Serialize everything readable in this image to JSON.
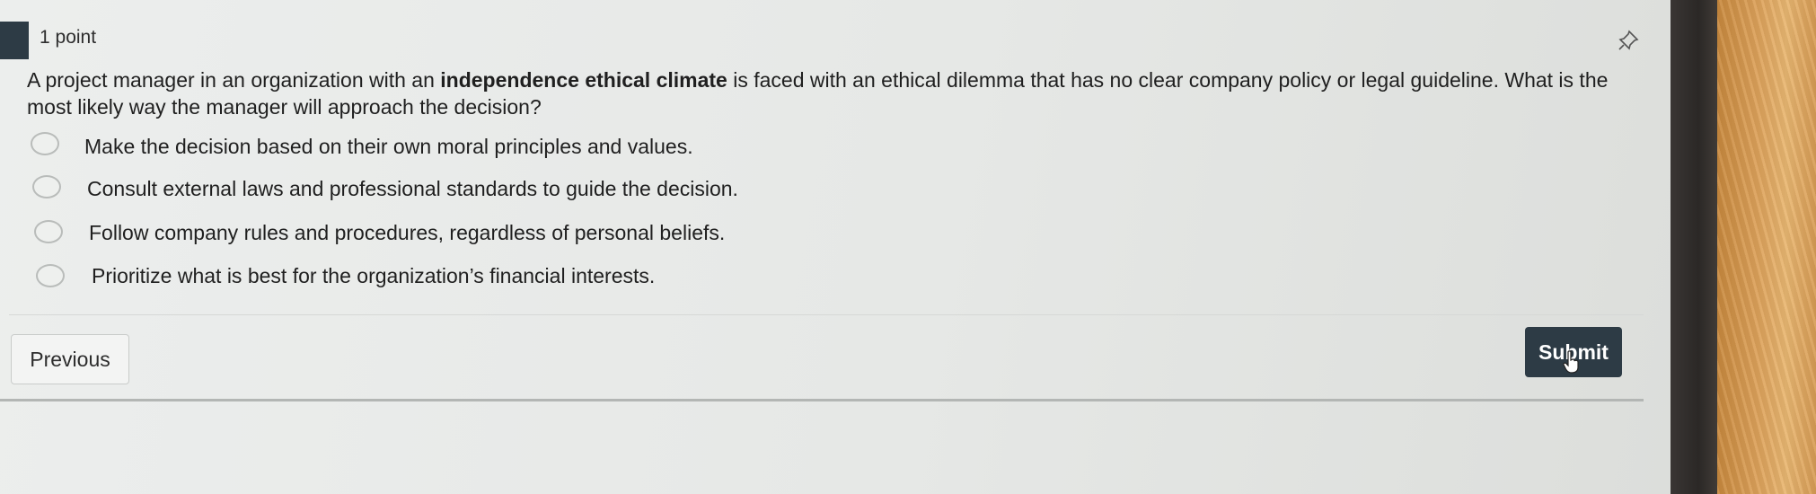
{
  "question": {
    "points_label": "1 point",
    "text_before": "A project manager in an organization with an ",
    "text_bold": "independence ethical climate",
    "text_after": " is faced with an ethical dilemma that has no clear company policy or legal guideline. What is the most likely way the manager will approach the decision?"
  },
  "answers": [
    {
      "label": "Make the decision based on their own moral principles and values.",
      "selected": false
    },
    {
      "label": "Consult external laws and professional standards to guide the decision.",
      "selected": false
    },
    {
      "label": "Follow company rules and procedures, regardless of personal beliefs.",
      "selected": false
    },
    {
      "label": "Prioritize what is best for the organization’s financial interests.",
      "selected": false
    }
  ],
  "nav": {
    "previous_label": "Previous",
    "submit_label": "Submit"
  },
  "icons": {
    "pin": "pin-icon",
    "cursor": "hand-pointer-icon"
  },
  "colors": {
    "submit_bg": "#2d3b45",
    "left_tab": "#2d3b45"
  }
}
